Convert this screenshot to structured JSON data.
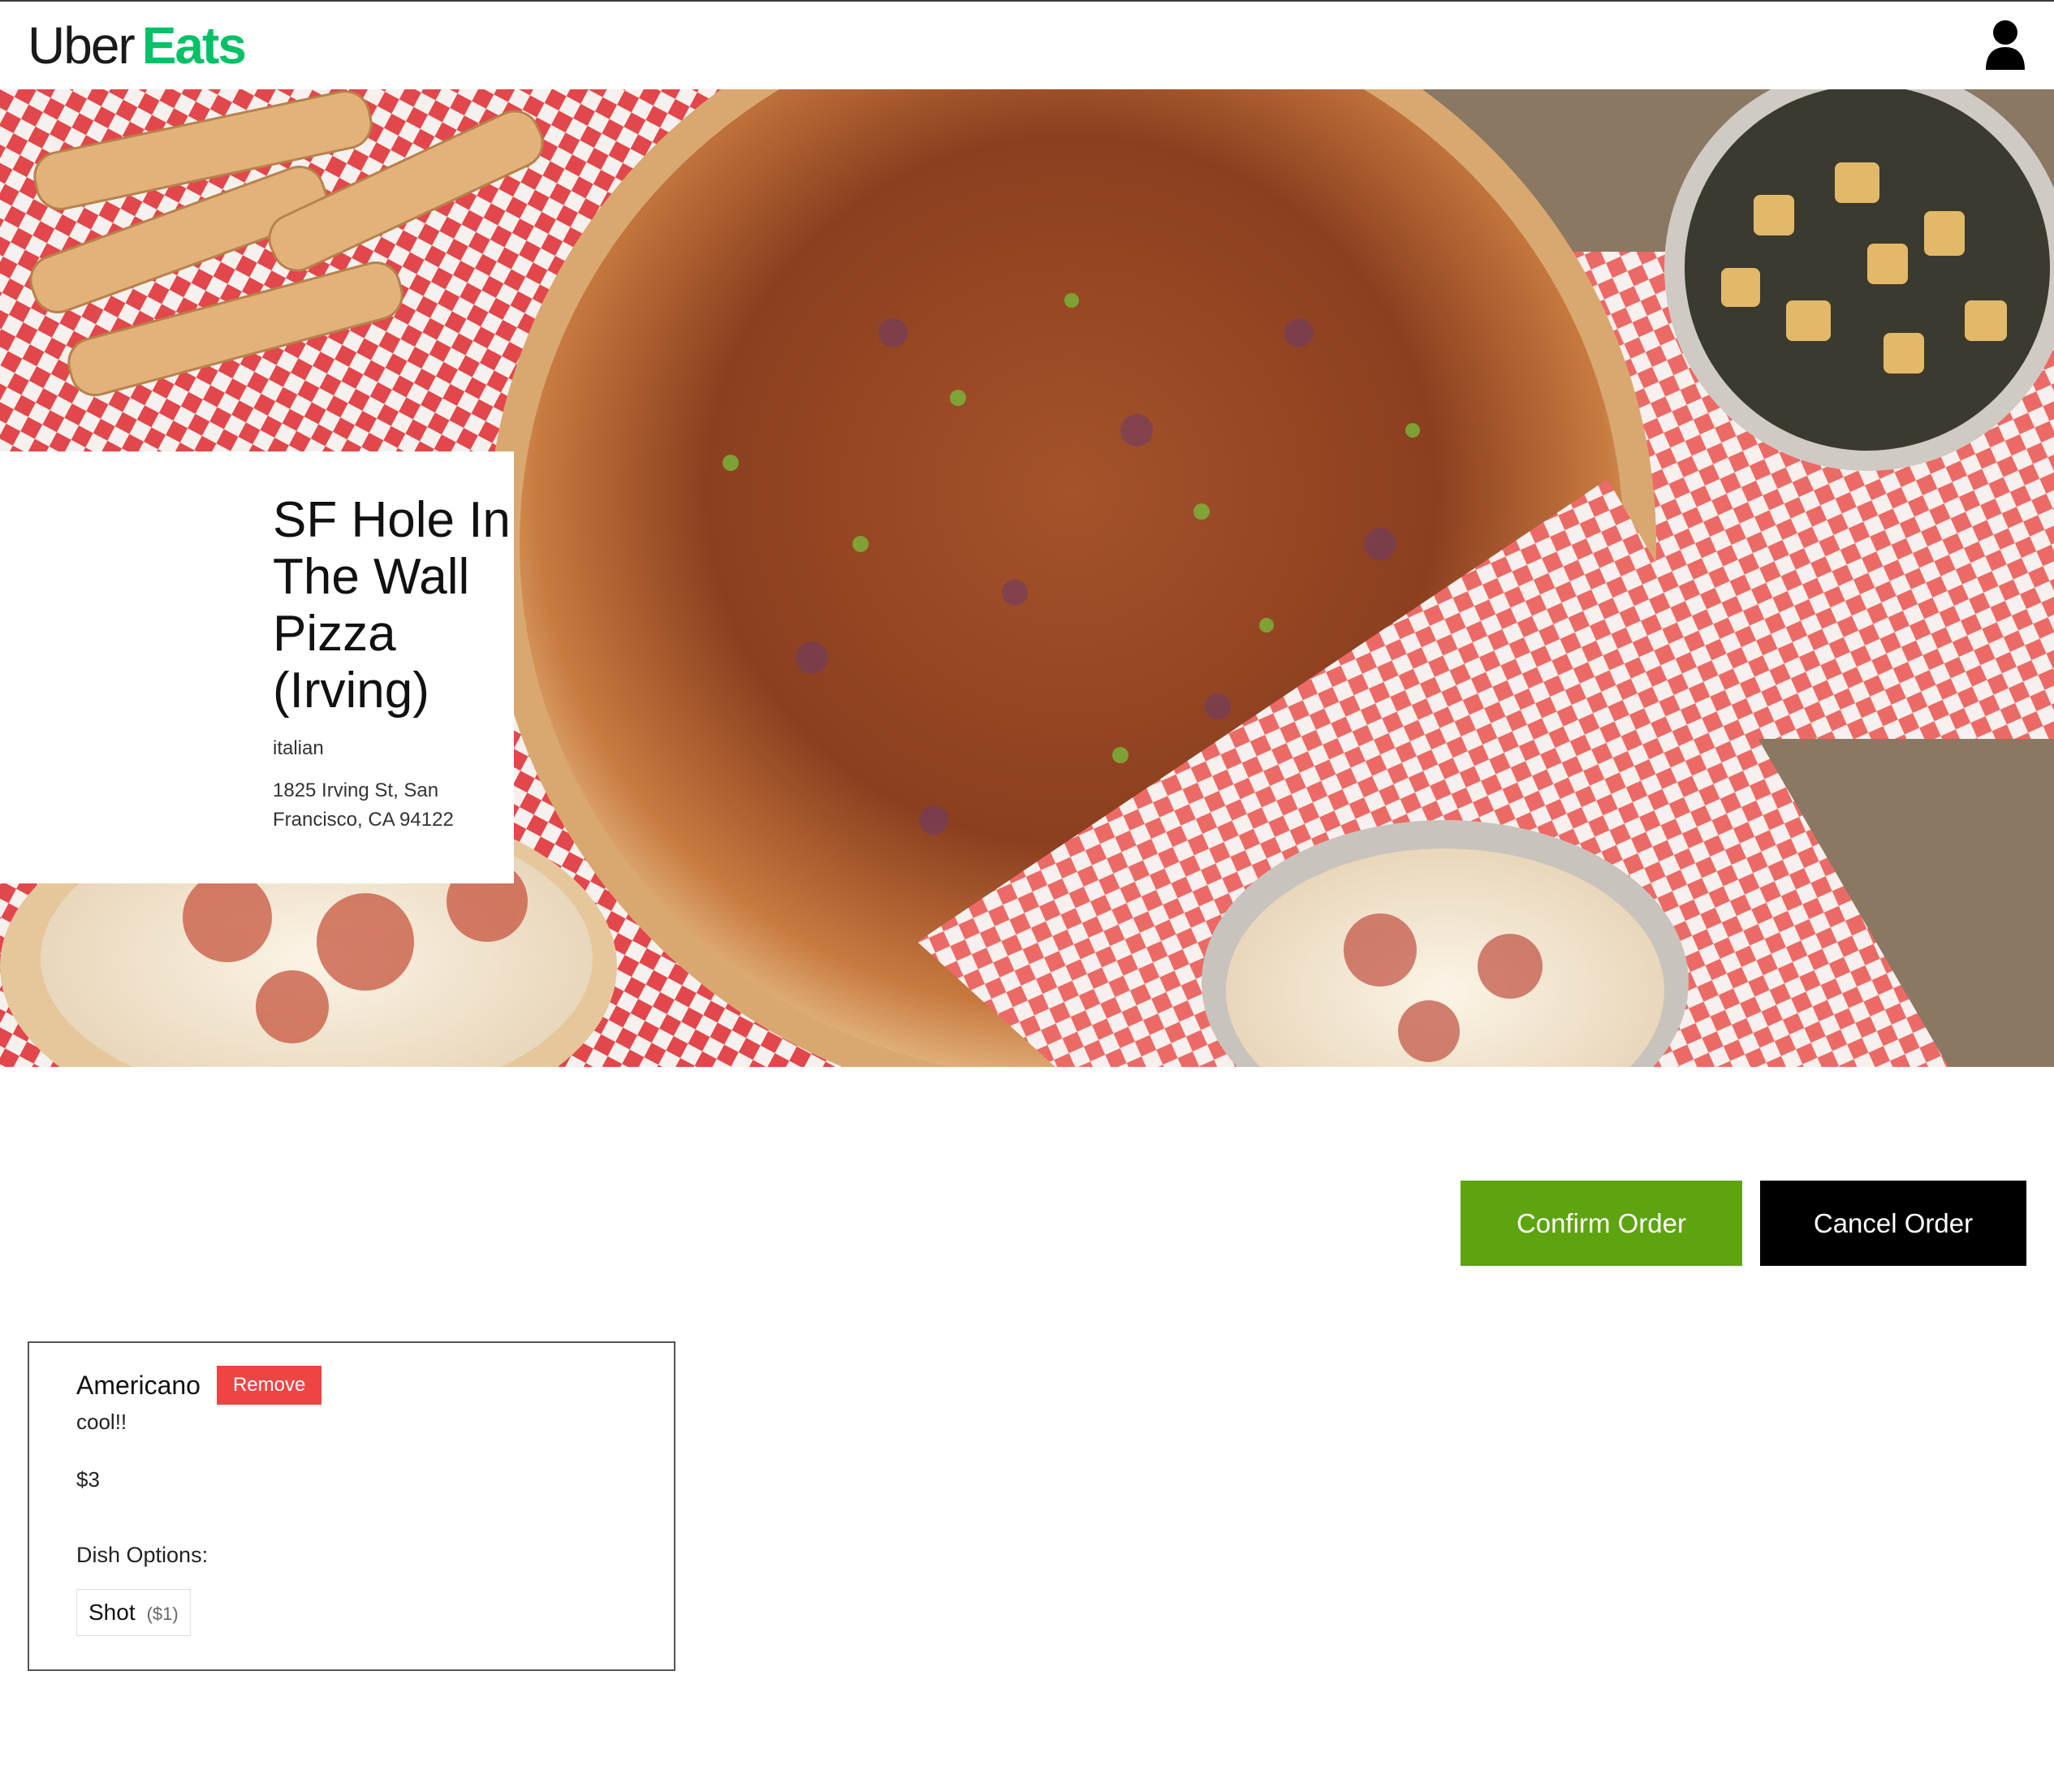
{
  "header": {
    "logo_uber": "Uber",
    "logo_eats": "Eats",
    "user_icon": "user-icon"
  },
  "restaurant": {
    "name": "SF Hole In The Wall Pizza (Irving)",
    "category": "italian",
    "address": "1825 Irving St, San Francisco, CA 94122"
  },
  "actions": {
    "confirm_label": "Confirm Order",
    "cancel_label": "Cancel Order"
  },
  "order_items": [
    {
      "name": "Americano",
      "remove_label": "Remove",
      "description": "cool!!",
      "price": "$3",
      "options_label": "Dish Options:",
      "options": [
        {
          "name": "Shot",
          "price": "($1)"
        }
      ]
    }
  ],
  "colors": {
    "brand_green": "#06c167",
    "confirm_green": "#5ea310",
    "remove_red": "#ef4444"
  }
}
